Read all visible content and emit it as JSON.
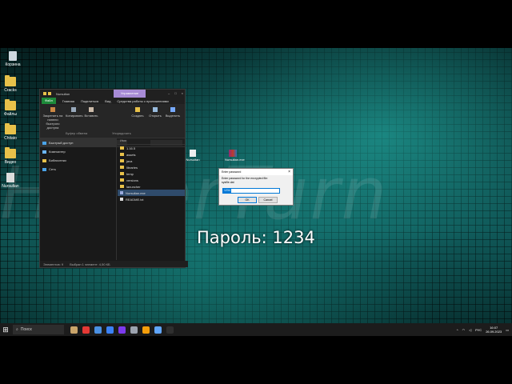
{
  "desktop": {
    "watermark": "HyperTurn",
    "overlay_text": "Пароль: 1234",
    "icons": [
      {
        "label": "Корзина",
        "kind": "bin"
      },
      {
        "label": "Cracks",
        "kind": "folder"
      },
      {
        "label": "Файлы",
        "kind": "folder"
      },
      {
        "label": "Chitato",
        "kind": "folder"
      },
      {
        "label": "Видео",
        "kind": "folder"
      },
      {
        "label": "Nursultan",
        "kind": "exe"
      }
    ],
    "right_icons": [
      {
        "label": "Nursultan"
      },
      {
        "label": "Nursultan.exe"
      }
    ]
  },
  "explorer": {
    "title": "Nursultan",
    "manage_tab": "Управление",
    "ribbon_tabs": [
      "Файл",
      "Главная",
      "Поделиться",
      "Вид",
      "Средства работы с приложениями"
    ],
    "ribbon_buttons": [
      "Закрепить на панели быстрого доступа",
      "Копировать",
      "Вставить",
      "Создать",
      "Открыть",
      "Выделить"
    ],
    "ribbon_groups": [
      "Буфер обмена",
      "Упорядочить"
    ],
    "address": "Nursultan",
    "nav_items": [
      "Быстрый доступ",
      "Компьютер",
      "Библиотеки",
      "Сеть"
    ],
    "list_header": "Имя",
    "files": [
      {
        "name": "1.16.5",
        "kind": "folder"
      },
      {
        "name": "assets",
        "kind": "folder"
      },
      {
        "name": "java",
        "kind": "folder"
      },
      {
        "name": "libraries",
        "kind": "folder"
      },
      {
        "name": "temp",
        "kind": "folder"
      },
      {
        "name": "versions",
        "kind": "folder"
      },
      {
        "name": "lanuncher",
        "kind": "folder"
      },
      {
        "name": "Nursultan.exe",
        "kind": "exe"
      },
      {
        "name": "README.txt",
        "kind": "doc"
      }
    ],
    "status": [
      "Элементов: 9",
      "Выбран 1 элемент: 4,50 КБ"
    ]
  },
  "dialog": {
    "title": "Enter password",
    "close_glyph": "×",
    "message": "Enter password for the encrypted file:",
    "file": "sysfile.dat",
    "value": "1234",
    "ok": "OK",
    "cancel": "Cancel"
  },
  "taskbar": {
    "search_placeholder": "Поиск",
    "lang": "РУС",
    "time": "16:07",
    "date": "26.09.2023",
    "app_colors": [
      "#c9a46a",
      "#e53935",
      "#4a90e2",
      "#3b82f6",
      "#7c3aed",
      "#9ca3af",
      "#f59e0b",
      "#60a5fa",
      "#2f2f2f"
    ]
  }
}
